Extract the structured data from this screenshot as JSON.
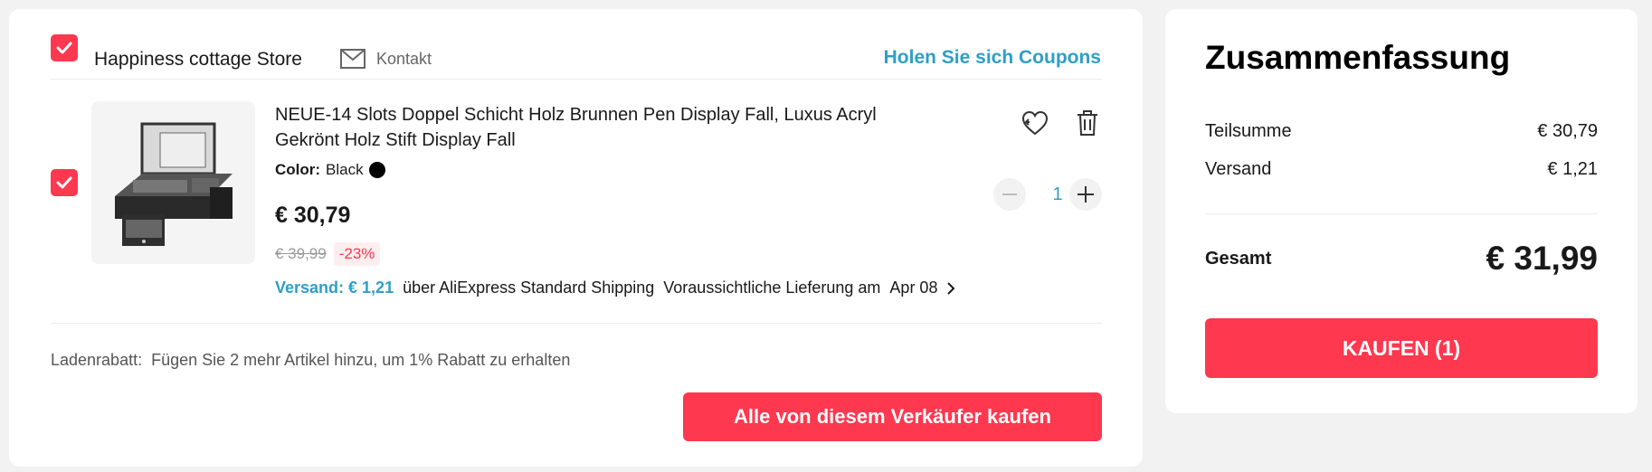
{
  "store": {
    "name": "Happiness cottage Store",
    "contact_label": "Kontakt",
    "coupons_label": "Holen Sie sich Coupons",
    "promo_label": "Ladenrabatt:",
    "promo_text": "Fügen Sie 2 mehr Artikel hinzu, um 1% Rabatt zu erhalten",
    "buy_all_label": "Alle von diesem Verkäufer kaufen"
  },
  "item": {
    "title": "NEUE-14 Slots Doppel Schicht Holz Brunnen Pen Display Fall, Luxus Acryl Gekrönt Holz Stift Display Fall",
    "color_key": "Color:",
    "color_value": "Black",
    "price": "€ 30,79",
    "old_price": "€ 39,99",
    "discount": "-23%",
    "shipping_price": "Versand: € 1,21",
    "shipping_method": "über AliExpress Standard Shipping",
    "delivery_text": "Voraussichtliche Lieferung am",
    "delivery_date": "Apr 08",
    "quantity": "1"
  },
  "summary": {
    "title": "Zusammenfassung",
    "subtotal_label": "Teilsumme",
    "subtotal_value": "€ 30,79",
    "shipping_label": "Versand",
    "shipping_value": "€ 1,21",
    "total_label": "Gesamt",
    "total_value": "€ 31,99",
    "checkout_label": "KAUFEN (1)"
  },
  "icons": {
    "checkbox": "check-icon",
    "contact": "envelope-icon",
    "wishlist": "heart-icon",
    "delete": "trash-icon",
    "decrease": "minus-icon",
    "increase": "plus-icon",
    "delivery": "chevron-right-icon"
  },
  "colors": {
    "accent": "#fd384f",
    "link": "#2e9fc7"
  }
}
